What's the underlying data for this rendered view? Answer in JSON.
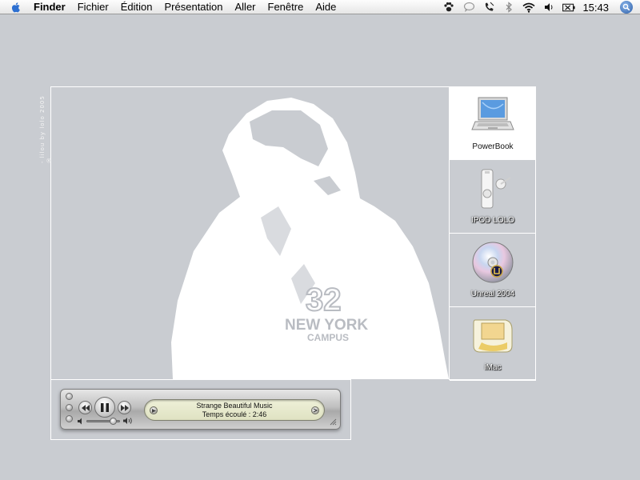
{
  "menubar": {
    "app_name": "Finder",
    "items": [
      "Fichier",
      "Édition",
      "Présentation",
      "Aller",
      "Fenêtre",
      "Aide"
    ],
    "status_icons": [
      "paw-icon",
      "speech-bubble-icon",
      "phone-icon",
      "bluetooth-icon",
      "wifi-icon",
      "volume-icon",
      "battery-icon"
    ],
    "clock": "15:43"
  },
  "desktop": {
    "credit": "- lilou by lolo 2005 ®",
    "accent_white": "#ffffff",
    "background": "#c9ccd1",
    "photo_text": {
      "number": "32",
      "line1": "NEW YORK",
      "line2": "CAMPUS"
    }
  },
  "icons": [
    {
      "label": "PowerBook",
      "icon": "laptop-icon",
      "selected": true
    },
    {
      "label": "IPOD LOLO",
      "icon": "ipod-shuffle-icon",
      "selected": false
    },
    {
      "label": "Unreal 2004",
      "icon": "cd-icon",
      "selected": false
    },
    {
      "label": "iMac",
      "icon": "imac-icon",
      "selected": false
    }
  ],
  "player": {
    "track": "Strange Beautiful Music",
    "elapsed": "Temps écoulé : 2:46",
    "volume_fraction": 0.85
  }
}
